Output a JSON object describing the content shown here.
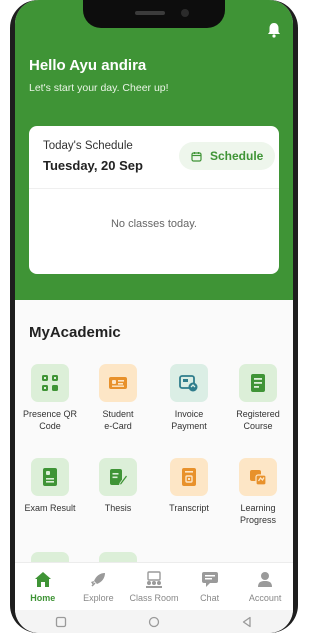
{
  "header": {
    "greeting": "Hello Ayu andira",
    "subtitle": "Let's start your day. Cheer up!"
  },
  "schedule_card": {
    "label": "Today's Schedule",
    "date": "Tuesday, 20 Sep",
    "button_label": "Schedule",
    "empty_message": "No classes today."
  },
  "academic": {
    "title": "MyAcademic",
    "items": [
      {
        "label": "Presence QR\nCode",
        "icon": "qr-code-icon"
      },
      {
        "label": "Student\ne-Card",
        "icon": "id-card-icon"
      },
      {
        "label": "Invoice\nPayment",
        "icon": "invoice-icon"
      },
      {
        "label": "Registered\nCourse",
        "icon": "course-book-icon"
      },
      {
        "label": "Exam Result",
        "icon": "exam-result-icon"
      },
      {
        "label": "Thesis",
        "icon": "thesis-icon"
      },
      {
        "label": "Transcript",
        "icon": "transcript-icon"
      },
      {
        "label": "Learning\nProgress",
        "icon": "learning-progress-icon"
      }
    ]
  },
  "bottom_nav": [
    {
      "label": "Home",
      "icon": "home-icon",
      "active": true
    },
    {
      "label": "Explore",
      "icon": "rocket-icon",
      "active": false
    },
    {
      "label": "Class Room",
      "icon": "classroom-icon",
      "active": false
    },
    {
      "label": "Chat",
      "icon": "chat-icon",
      "active": false
    },
    {
      "label": "Account",
      "icon": "account-icon",
      "active": false
    }
  ],
  "colors": {
    "primary_green": "#3f9436",
    "light_green": "#dcefd8",
    "light_orange": "#fde6c6",
    "orange": "#e8912b"
  }
}
